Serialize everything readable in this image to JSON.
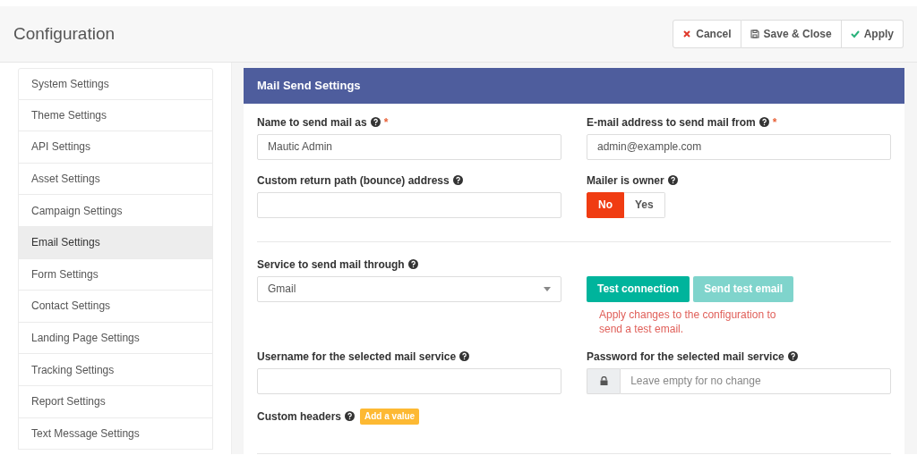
{
  "header": {
    "title": "Configuration",
    "buttons": [
      {
        "kind": "cancel",
        "label": "Cancel"
      },
      {
        "kind": "save",
        "label": "Save & Close"
      },
      {
        "kind": "apply",
        "label": "Apply"
      }
    ]
  },
  "sidebar": {
    "items": [
      {
        "label": "System Settings",
        "selected": false
      },
      {
        "label": "Theme Settings",
        "selected": false
      },
      {
        "label": "API Settings",
        "selected": false
      },
      {
        "label": "Asset Settings",
        "selected": false
      },
      {
        "label": "Campaign Settings",
        "selected": false
      },
      {
        "label": "Email Settings",
        "selected": true
      },
      {
        "label": "Form Settings",
        "selected": false
      },
      {
        "label": "Contact Settings",
        "selected": false
      },
      {
        "label": "Landing Page Settings",
        "selected": false
      },
      {
        "label": "Tracking Settings",
        "selected": false
      },
      {
        "label": "Report Settings",
        "selected": false
      },
      {
        "label": "Text Message Settings",
        "selected": false
      }
    ]
  },
  "panel": {
    "title": "Mail Send Settings",
    "rows": [
      {
        "kind": "fields",
        "fields": [
          {
            "kind": "text",
            "label": "Name to send mail as",
            "required_mark": "*",
            "value": "Mautic Admin"
          },
          {
            "kind": "text",
            "label": "E-mail address to send mail from",
            "required_mark": "*",
            "value": "admin@example.com"
          }
        ]
      },
      {
        "kind": "fields",
        "fields": [
          {
            "kind": "text",
            "label": "Custom return path (bounce) address"
          },
          {
            "kind": "toggle",
            "label": "Mailer is owner",
            "options": [
              {
                "label": "No",
                "selected": true
              },
              {
                "label": "Yes",
                "selected": false
              }
            ]
          }
        ]
      },
      {
        "kind": "divider"
      },
      {
        "kind": "fields",
        "fields": [
          {
            "kind": "select",
            "label": "Service to send mail through",
            "value": "Gmail"
          },
          {
            "kind": "actions",
            "buttons": [
              {
                "label": "Test connection",
                "disabled": false
              },
              {
                "label": "Send test email",
                "disabled": true
              }
            ],
            "note": "Apply changes to the configuration to send a test email."
          }
        ]
      },
      {
        "kind": "fields",
        "fields": [
          {
            "kind": "text",
            "label": "Username for the selected mail service"
          },
          {
            "kind": "password",
            "label": "Password for the selected mail service",
            "placeholder": "Leave empty for no change"
          }
        ]
      },
      {
        "kind": "fields",
        "fields": [
          {
            "kind": "headers",
            "label": "Custom headers",
            "button": "Add a value"
          }
        ]
      },
      {
        "kind": "divider"
      }
    ]
  }
}
